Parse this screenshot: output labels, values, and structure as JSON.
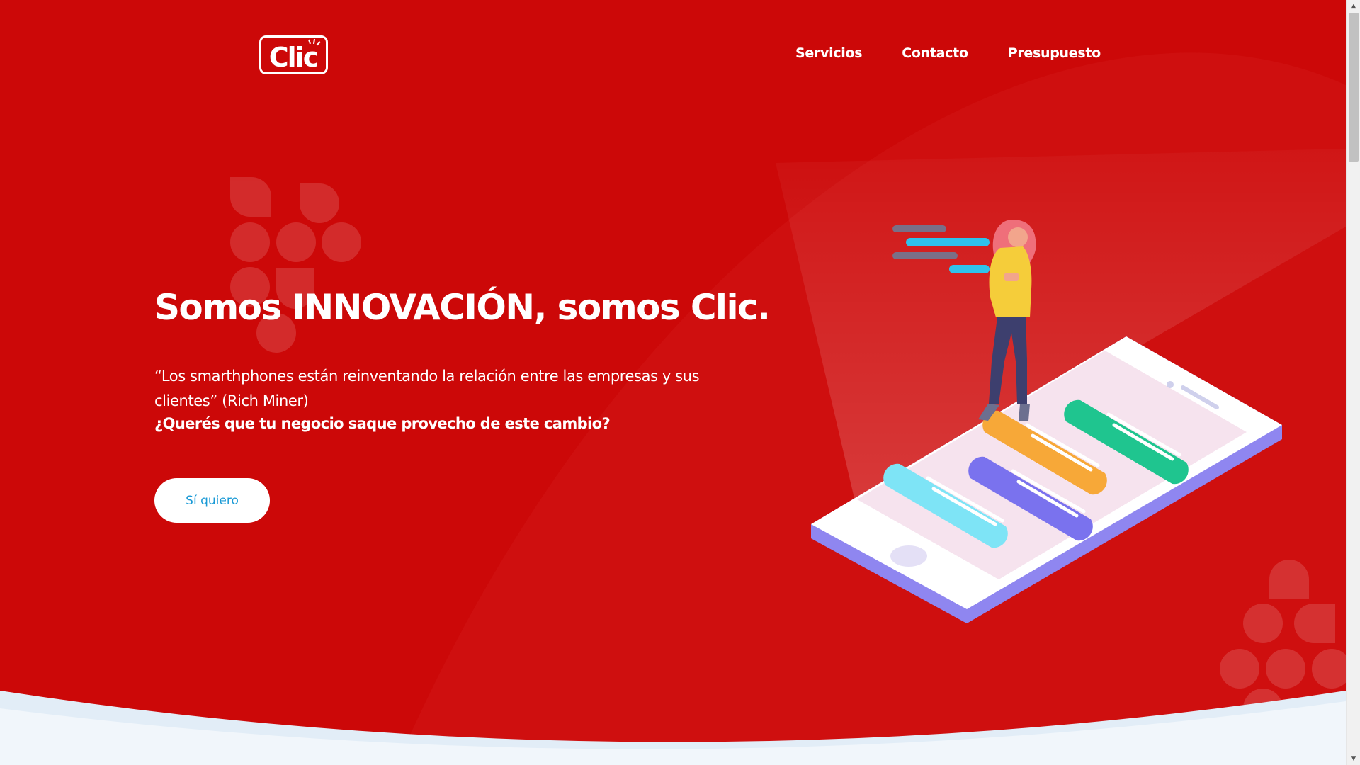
{
  "brand": {
    "logo_text": "Clic",
    "primary_color": "#cc0808",
    "accent_blue": "#1a9ad6"
  },
  "nav": {
    "items": [
      {
        "label": "Servicios"
      },
      {
        "label": "Contacto"
      },
      {
        "label": "Presupuesto"
      }
    ]
  },
  "hero": {
    "title": "Somos INNOVACIÓN, somos Clic.",
    "quote": "“Los smarthphones están reinventando la relación entre las empresas y sus clientes” (Rich Miner)",
    "question": "¿Querés que tu negocio saque provecho de este cambio?",
    "cta_label": "Sí quiero"
  },
  "illustration": {
    "icon": "woman-on-smartphone-chat-illustration"
  }
}
